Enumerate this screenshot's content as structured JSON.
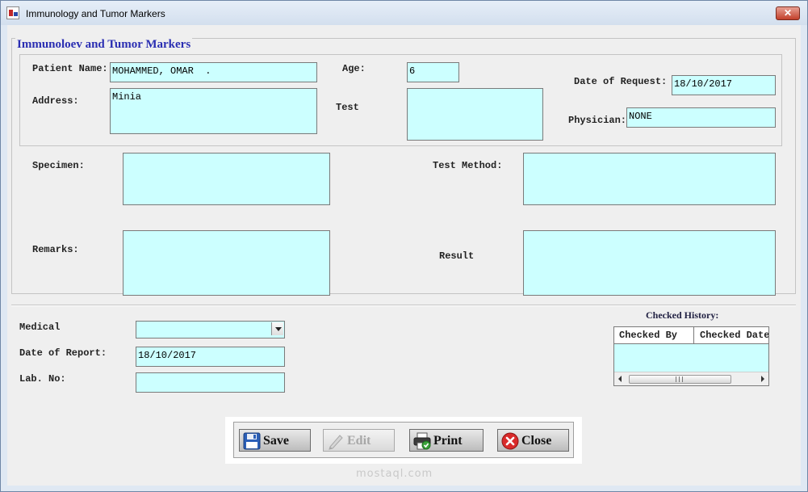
{
  "window": {
    "title": "Immunology and Tumor Markers",
    "close_glyph": "✕"
  },
  "group": {
    "title": "Immunoloev and Tumor Markers"
  },
  "patient": {
    "name_label": "Patient Name:",
    "name_value": "MOHAMMED, OMAR  .",
    "age_label": "Age:",
    "age_value": "6",
    "date_request_label": "Date of Request:",
    "date_request_value": "18/10/2017",
    "address_label": "Address:",
    "address_value": "Minia",
    "test_label": "Test",
    "test_value": "",
    "physician_label": "Physician:",
    "physician_value": "NONE"
  },
  "details": {
    "specimen_label": "Specimen:",
    "specimen_value": "",
    "test_method_label": "Test Method:",
    "test_method_value": "",
    "remarks_label": "Remarks:",
    "remarks_value": "",
    "result_label": "Result",
    "result_value": ""
  },
  "report": {
    "medical_label": "Medical",
    "medical_value": "",
    "date_report_label": "Date of Report:",
    "date_report_value": "18/10/2017",
    "lab_no_label": "Lab. No:",
    "lab_no_value": ""
  },
  "history": {
    "title": "Checked History:",
    "columns": [
      "Checked By",
      "Checked Date"
    ],
    "scroll_grip": "III"
  },
  "buttons": {
    "save": "Save",
    "edit": "Edit",
    "print": "Print",
    "close": "Close"
  },
  "watermark": "mostaql.com",
  "colors": {
    "field_bg": "#ccffff",
    "group_title": "#2a2eb2",
    "client_bg": "#efefef"
  },
  "icons": {
    "save": "floppy-disk-icon",
    "edit": "pencil-icon",
    "print": "printer-check-icon",
    "close": "red-x-circle-icon"
  }
}
